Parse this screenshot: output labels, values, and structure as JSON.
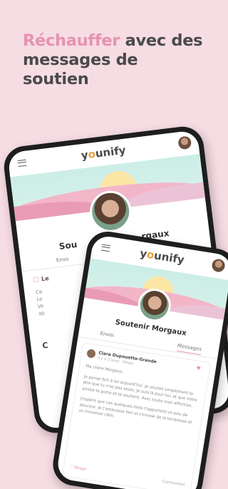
{
  "headline": {
    "accent": "Réchauffer",
    "rest": " avec des messages de soutien"
  },
  "app": {
    "logo_y": "y",
    "logo_o": "o",
    "logo_rest": "unify"
  },
  "back_phone": {
    "title": "Sou",
    "title_tail": "rgaux",
    "tab_left": "Envo",
    "side_text": [
      "Le",
      "Ce",
      "Le",
      "Ve",
      "ap"
    ],
    "bottom_letter": "C"
  },
  "front_phone": {
    "title": "Soutenir Morgaux",
    "tab_left": "Envoi",
    "tab_right": "Messages",
    "message": {
      "author": "Clara Dupouette-Grande",
      "date": "Il y a 2 jours · Réagir",
      "greeting": "Ma chère Morgaux,",
      "paragraph1": "Je pense fort à toi aujourd'hui. Je voulais simplement te dire que tu n'es pas seule. Je suis là pour toi, et que notre amitié te porte et te soutient. Avec toute mon affection.",
      "paragraph2": "J'espère que ces quelques mots t'apportent un peu de douceur. Je t'embrasse fort et t'envoie de la tendresse et un immense câlin.",
      "like": "♡ Réagir",
      "comment": "Commenter"
    }
  },
  "colors": {
    "background": "#f6dce3",
    "accent": "#e593ae",
    "text": "#4a4a4a"
  }
}
